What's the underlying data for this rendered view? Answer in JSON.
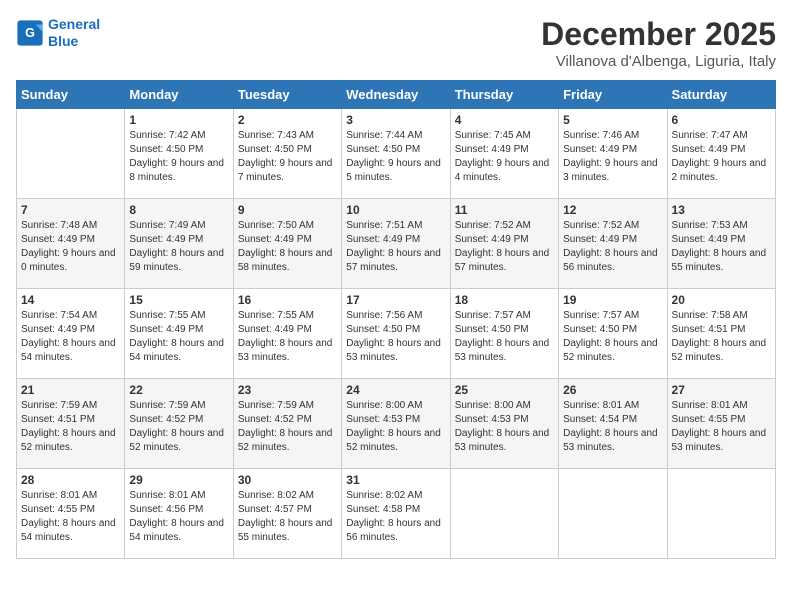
{
  "header": {
    "logo_line1": "General",
    "logo_line2": "Blue",
    "month": "December 2025",
    "location": "Villanova d'Albenga, Liguria, Italy"
  },
  "days_of_week": [
    "Sunday",
    "Monday",
    "Tuesday",
    "Wednesday",
    "Thursday",
    "Friday",
    "Saturday"
  ],
  "weeks": [
    [
      {
        "day": "",
        "text": ""
      },
      {
        "day": "1",
        "text": "Sunrise: 7:42 AM\nSunset: 4:50 PM\nDaylight: 9 hours and 8 minutes."
      },
      {
        "day": "2",
        "text": "Sunrise: 7:43 AM\nSunset: 4:50 PM\nDaylight: 9 hours and 7 minutes."
      },
      {
        "day": "3",
        "text": "Sunrise: 7:44 AM\nSunset: 4:50 PM\nDaylight: 9 hours and 5 minutes."
      },
      {
        "day": "4",
        "text": "Sunrise: 7:45 AM\nSunset: 4:49 PM\nDaylight: 9 hours and 4 minutes."
      },
      {
        "day": "5",
        "text": "Sunrise: 7:46 AM\nSunset: 4:49 PM\nDaylight: 9 hours and 3 minutes."
      },
      {
        "day": "6",
        "text": "Sunrise: 7:47 AM\nSunset: 4:49 PM\nDaylight: 9 hours and 2 minutes."
      }
    ],
    [
      {
        "day": "7",
        "text": "Sunrise: 7:48 AM\nSunset: 4:49 PM\nDaylight: 9 hours and 0 minutes."
      },
      {
        "day": "8",
        "text": "Sunrise: 7:49 AM\nSunset: 4:49 PM\nDaylight: 8 hours and 59 minutes."
      },
      {
        "day": "9",
        "text": "Sunrise: 7:50 AM\nSunset: 4:49 PM\nDaylight: 8 hours and 58 minutes."
      },
      {
        "day": "10",
        "text": "Sunrise: 7:51 AM\nSunset: 4:49 PM\nDaylight: 8 hours and 57 minutes."
      },
      {
        "day": "11",
        "text": "Sunrise: 7:52 AM\nSunset: 4:49 PM\nDaylight: 8 hours and 57 minutes."
      },
      {
        "day": "12",
        "text": "Sunrise: 7:52 AM\nSunset: 4:49 PM\nDaylight: 8 hours and 56 minutes."
      },
      {
        "day": "13",
        "text": "Sunrise: 7:53 AM\nSunset: 4:49 PM\nDaylight: 8 hours and 55 minutes."
      }
    ],
    [
      {
        "day": "14",
        "text": "Sunrise: 7:54 AM\nSunset: 4:49 PM\nDaylight: 8 hours and 54 minutes."
      },
      {
        "day": "15",
        "text": "Sunrise: 7:55 AM\nSunset: 4:49 PM\nDaylight: 8 hours and 54 minutes."
      },
      {
        "day": "16",
        "text": "Sunrise: 7:55 AM\nSunset: 4:49 PM\nDaylight: 8 hours and 53 minutes."
      },
      {
        "day": "17",
        "text": "Sunrise: 7:56 AM\nSunset: 4:50 PM\nDaylight: 8 hours and 53 minutes."
      },
      {
        "day": "18",
        "text": "Sunrise: 7:57 AM\nSunset: 4:50 PM\nDaylight: 8 hours and 53 minutes."
      },
      {
        "day": "19",
        "text": "Sunrise: 7:57 AM\nSunset: 4:50 PM\nDaylight: 8 hours and 52 minutes."
      },
      {
        "day": "20",
        "text": "Sunrise: 7:58 AM\nSunset: 4:51 PM\nDaylight: 8 hours and 52 minutes."
      }
    ],
    [
      {
        "day": "21",
        "text": "Sunrise: 7:59 AM\nSunset: 4:51 PM\nDaylight: 8 hours and 52 minutes."
      },
      {
        "day": "22",
        "text": "Sunrise: 7:59 AM\nSunset: 4:52 PM\nDaylight: 8 hours and 52 minutes."
      },
      {
        "day": "23",
        "text": "Sunrise: 7:59 AM\nSunset: 4:52 PM\nDaylight: 8 hours and 52 minutes."
      },
      {
        "day": "24",
        "text": "Sunrise: 8:00 AM\nSunset: 4:53 PM\nDaylight: 8 hours and 52 minutes."
      },
      {
        "day": "25",
        "text": "Sunrise: 8:00 AM\nSunset: 4:53 PM\nDaylight: 8 hours and 53 minutes."
      },
      {
        "day": "26",
        "text": "Sunrise: 8:01 AM\nSunset: 4:54 PM\nDaylight: 8 hours and 53 minutes."
      },
      {
        "day": "27",
        "text": "Sunrise: 8:01 AM\nSunset: 4:55 PM\nDaylight: 8 hours and 53 minutes."
      }
    ],
    [
      {
        "day": "28",
        "text": "Sunrise: 8:01 AM\nSunset: 4:55 PM\nDaylight: 8 hours and 54 minutes."
      },
      {
        "day": "29",
        "text": "Sunrise: 8:01 AM\nSunset: 4:56 PM\nDaylight: 8 hours and 54 minutes."
      },
      {
        "day": "30",
        "text": "Sunrise: 8:02 AM\nSunset: 4:57 PM\nDaylight: 8 hours and 55 minutes."
      },
      {
        "day": "31",
        "text": "Sunrise: 8:02 AM\nSunset: 4:58 PM\nDaylight: 8 hours and 56 minutes."
      },
      {
        "day": "",
        "text": ""
      },
      {
        "day": "",
        "text": ""
      },
      {
        "day": "",
        "text": ""
      }
    ]
  ]
}
